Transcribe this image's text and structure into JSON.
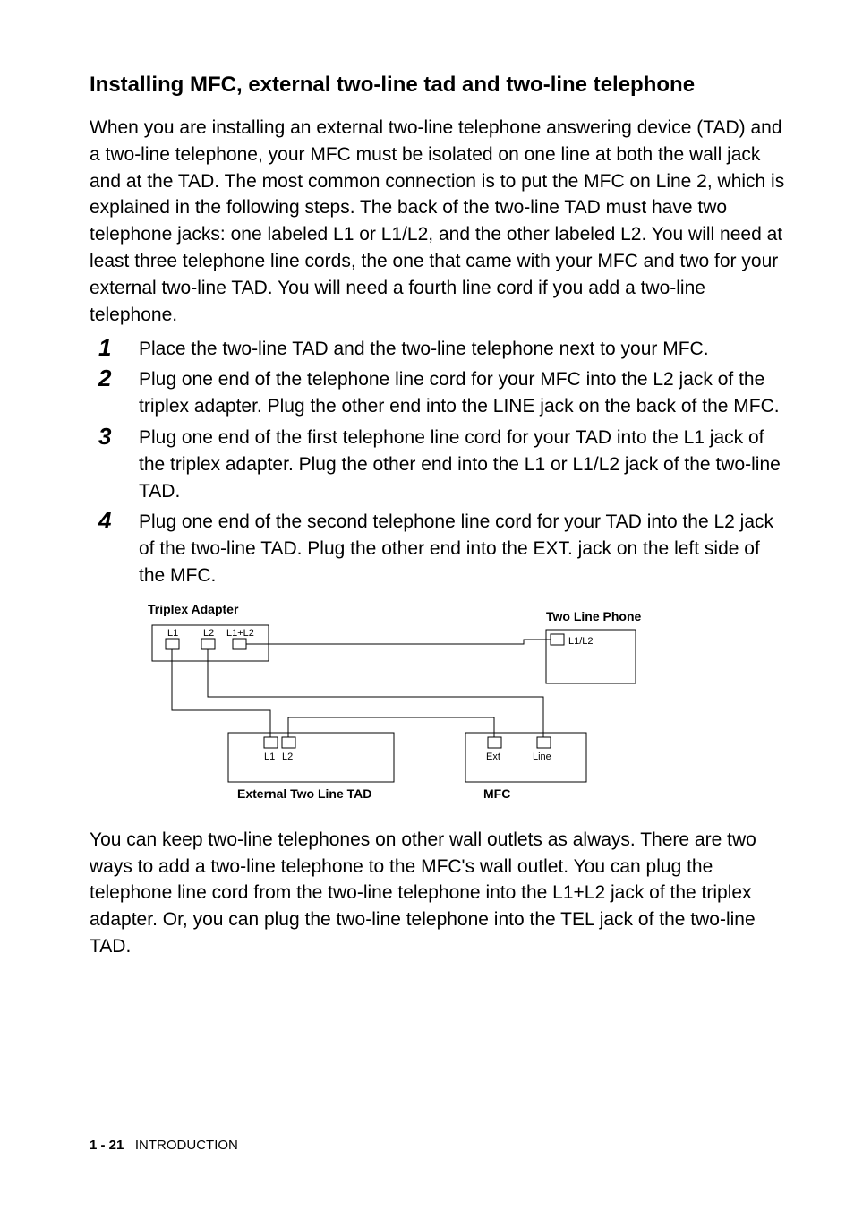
{
  "heading": "Installing MFC, external two-line tad and two-line telephone",
  "intro": "When you are installing an external two-line telephone answering device (TAD) and a two-line telephone, your MFC must be isolated on one line at both the wall jack and at the TAD. The most common connection is to put the MFC on Line 2, which is explained in the following steps. The back of the two-line TAD must have two telephone jacks: one labeled L1 or L1/L2, and the other labeled L2. You will need at least three telephone line cords, the one that came with your MFC and two for your external two-line TAD. You will need a fourth line cord if you add a two-line telephone.",
  "steps": [
    {
      "n": "1",
      "t": "Place the two-line TAD and the two-line telephone next to your MFC."
    },
    {
      "n": "2",
      "t": "Plug one end of the telephone line cord for your MFC into the L2 jack of the triplex adapter. Plug the other end into the LINE jack on the back of the MFC."
    },
    {
      "n": "3",
      "t": "Plug one end of the first telephone line cord for your TAD into the L1 jack of the triplex adapter. Plug the other end into the L1 or L1/L2 jack of the two-line TAD."
    },
    {
      "n": "4",
      "t": "Plug one end of the second telephone line cord for your TAD into the L2 jack of the two-line TAD. Plug the other end into the EXT. jack on the left side of the MFC."
    }
  ],
  "diagram": {
    "triplex_label": "Triplex Adapter",
    "two_line_phone_label": "Two Line Phone",
    "external_tad_label": "External Two Line TAD",
    "mfc_label": "MFC",
    "L1": "L1",
    "L2": "L2",
    "L1L2": "L1+L2",
    "L1slashL2": "L1/L2",
    "Ext": "Ext",
    "Line": "Line",
    "tad_L1": "L1",
    "tad_L2": "L2"
  },
  "outro": "You can keep two-line telephones on other wall outlets as always. There are two ways to add a two-line telephone to the MFC's wall outlet. You can plug the telephone line cord from the two-line telephone into the L1+L2 jack of the triplex adapter. Or, you can plug the two-line telephone into the TEL jack of the two-line TAD.",
  "footer_page": "1 - 21",
  "footer_section": "INTRODUCTION"
}
